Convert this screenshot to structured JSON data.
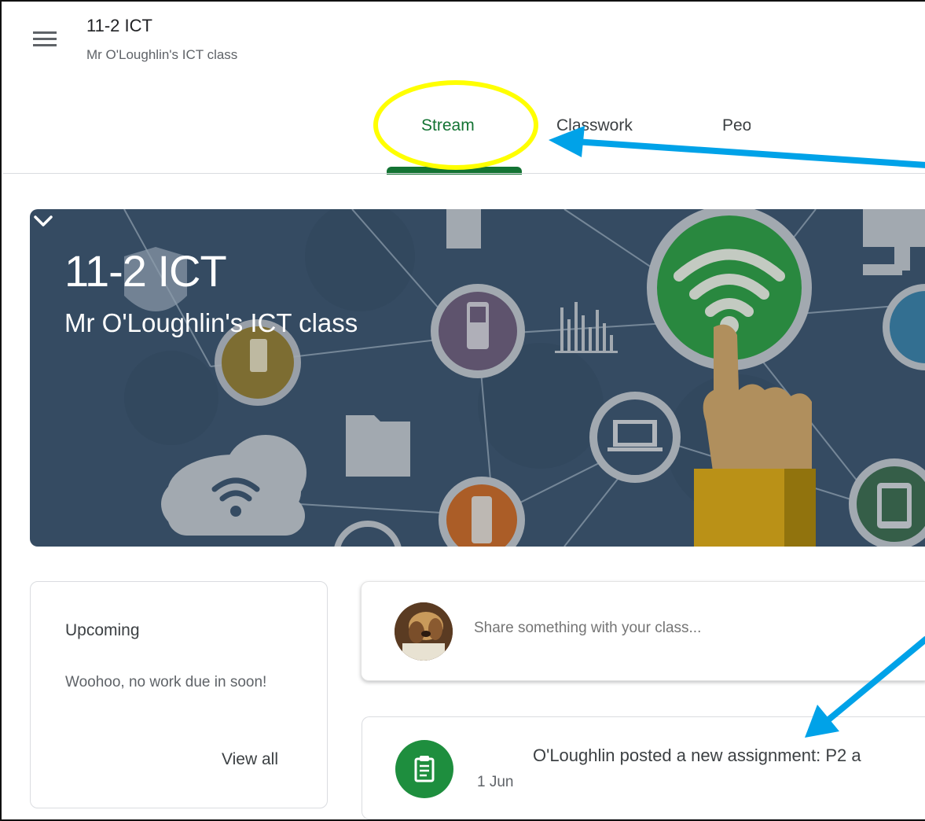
{
  "header": {
    "class_name": "11-2 ICT",
    "class_section": "Mr O'Loughlin's ICT class"
  },
  "tabs": [
    {
      "label": "Stream",
      "active": true
    },
    {
      "label": "Classwork",
      "active": false
    },
    {
      "label": "People",
      "active": false
    }
  ],
  "banner": {
    "title": "11-2 ICT",
    "subtitle": "Mr O'Loughlin's ICT class"
  },
  "upcoming": {
    "title": "Upcoming",
    "message": "Woohoo, no work due in soon!",
    "view_all": "View all"
  },
  "share": {
    "placeholder": "Share something with your class..."
  },
  "stream_post": {
    "text": "O'Loughlin posted a new assignment: P2 a",
    "date": "1 Jun"
  },
  "colors": {
    "accent_green": "#137333",
    "assignment_green": "#1e8e3e",
    "annotation_yellow": "#ffff00",
    "annotation_blue": "#00a2e8",
    "banner_blue": "#3d5670"
  }
}
